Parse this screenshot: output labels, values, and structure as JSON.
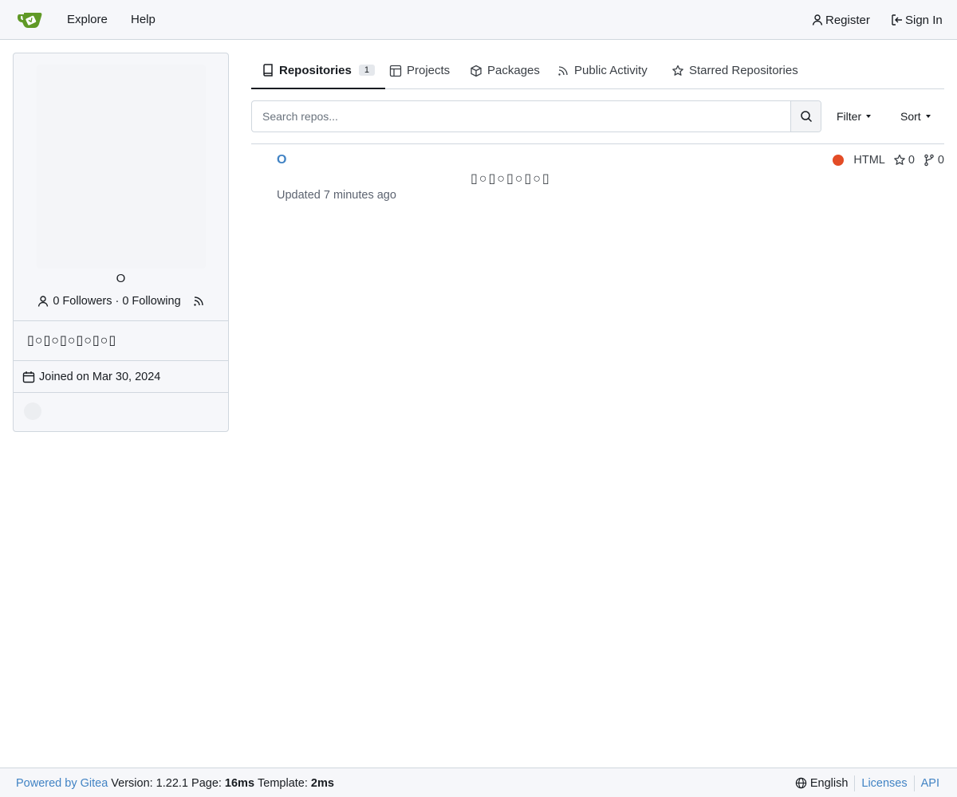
{
  "navbar": {
    "logo_icon": "gitea-logo-icon",
    "explore_label": "Explore",
    "help_label": "Help",
    "register_label": "Register",
    "signin_label": "Sign In"
  },
  "profile": {
    "name": "O",
    "followers_label": "0 Followers",
    "separator": "·",
    "following_label": "0 Following",
    "bio": "▯○▯○▯○▯○▯○▯",
    "joined_label": "Joined on Mar 30, 2024"
  },
  "tabs": [
    {
      "label": "Repositories",
      "count": "1",
      "icon": "repo-icon",
      "active": true
    },
    {
      "label": "Projects",
      "icon": "project-icon"
    },
    {
      "label": "Packages",
      "icon": "package-icon"
    },
    {
      "label": "Public Activity",
      "icon": "rss-icon"
    },
    {
      "label": "Starred Repositories",
      "icon": "star-icon"
    }
  ],
  "search": {
    "placeholder": "Search repos...",
    "value": "",
    "filter_label": "Filter",
    "sort_label": "Sort"
  },
  "repos": [
    {
      "name": "O",
      "description": "▯○▯○▯○▯○▯",
      "updated": "Updated 7 minutes ago",
      "language": "HTML",
      "language_color": "#e34c26",
      "stars": "0",
      "forks": "0"
    }
  ],
  "footer": {
    "powered_by": "Powered by Gitea",
    "version_text": "Version: 1.22.1 Page:",
    "page_time": "16ms",
    "template_label": "Template:",
    "template_time": "2ms",
    "language": "English",
    "licenses": "Licenses",
    "api": "API"
  },
  "colors": {
    "accent": "#4183c4",
    "logo_green": "#609926",
    "nav_bg": "#f6f7fa"
  }
}
